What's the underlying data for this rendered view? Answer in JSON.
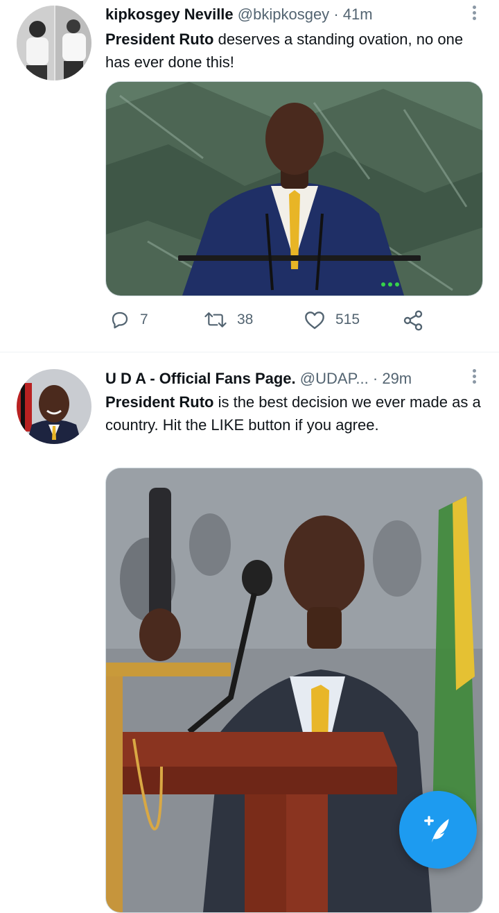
{
  "tweets": [
    {
      "display_name": "kipkosgey Neville",
      "handle": "@bkipkosgey",
      "separator": "·",
      "time": "41m",
      "text_bold": "President Ruto",
      "text_rest": " deserves a standing ovation, no one has ever done this!",
      "replies": "7",
      "retweets": "38",
      "likes": "515"
    },
    {
      "display_name": "U D A - Official Fans Page.",
      "handle": "@UDAP...",
      "separator": "·",
      "time": "29m",
      "text_bold": "President Ruto",
      "text_rest": " is the best decision we ever made as a country. Hit the LIKE button if you agree."
    }
  ],
  "icons": {
    "reply": "reply-icon",
    "retweet": "retweet-icon",
    "like": "heart-icon",
    "share": "share-icon",
    "more": "more-vertical-icon",
    "compose": "compose-tweet-icon"
  },
  "colors": {
    "accent": "#1d9bf0",
    "secondary_text": "#536471",
    "primary_text": "#0f1419"
  }
}
